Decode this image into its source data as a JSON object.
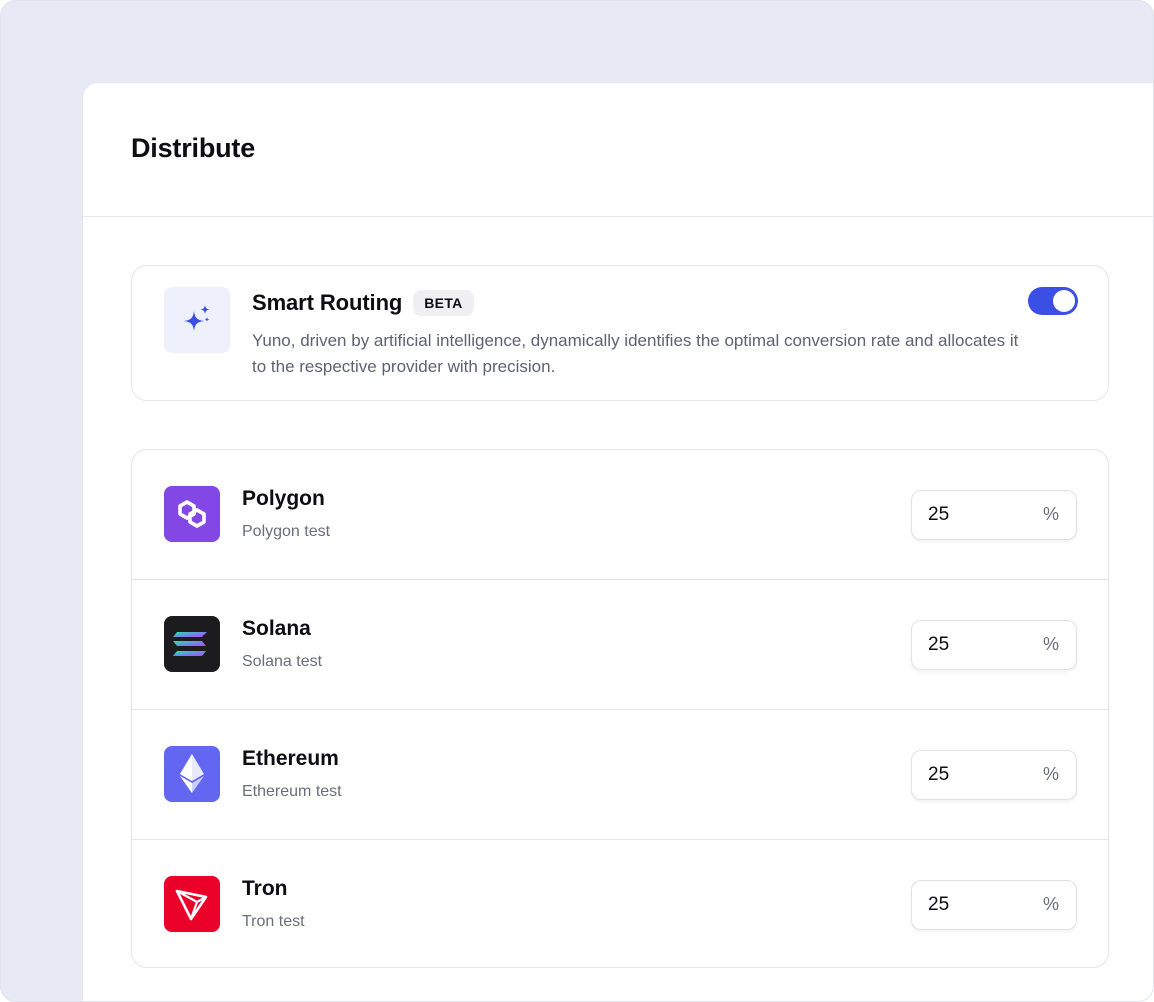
{
  "header": {
    "title": "Distribute"
  },
  "smart_routing": {
    "title": "Smart Routing",
    "badge": "BETA",
    "description": "Yuno, driven by artificial intelligence, dynamically identifies the optimal conversion rate and allocates it to the respective provider with precision.",
    "enabled": true,
    "icon": "sparkles-icon",
    "accent_color": "#3b4fe4"
  },
  "providers": [
    {
      "name": "Polygon",
      "subtitle": "Polygon test",
      "value": "25",
      "unit": "%",
      "icon": "polygon-logo-icon",
      "color": "#8247e5"
    },
    {
      "name": "Solana",
      "subtitle": "Solana test",
      "value": "25",
      "unit": "%",
      "icon": "solana-logo-icon",
      "color": "#1c1c1e"
    },
    {
      "name": "Ethereum",
      "subtitle": "Ethereum test",
      "value": "25",
      "unit": "%",
      "icon": "ethereum-logo-icon",
      "color": "#6366f1"
    },
    {
      "name": "Tron",
      "subtitle": "Tron test",
      "value": "25",
      "unit": "%",
      "icon": "tron-logo-icon",
      "color": "#eb0029"
    }
  ]
}
